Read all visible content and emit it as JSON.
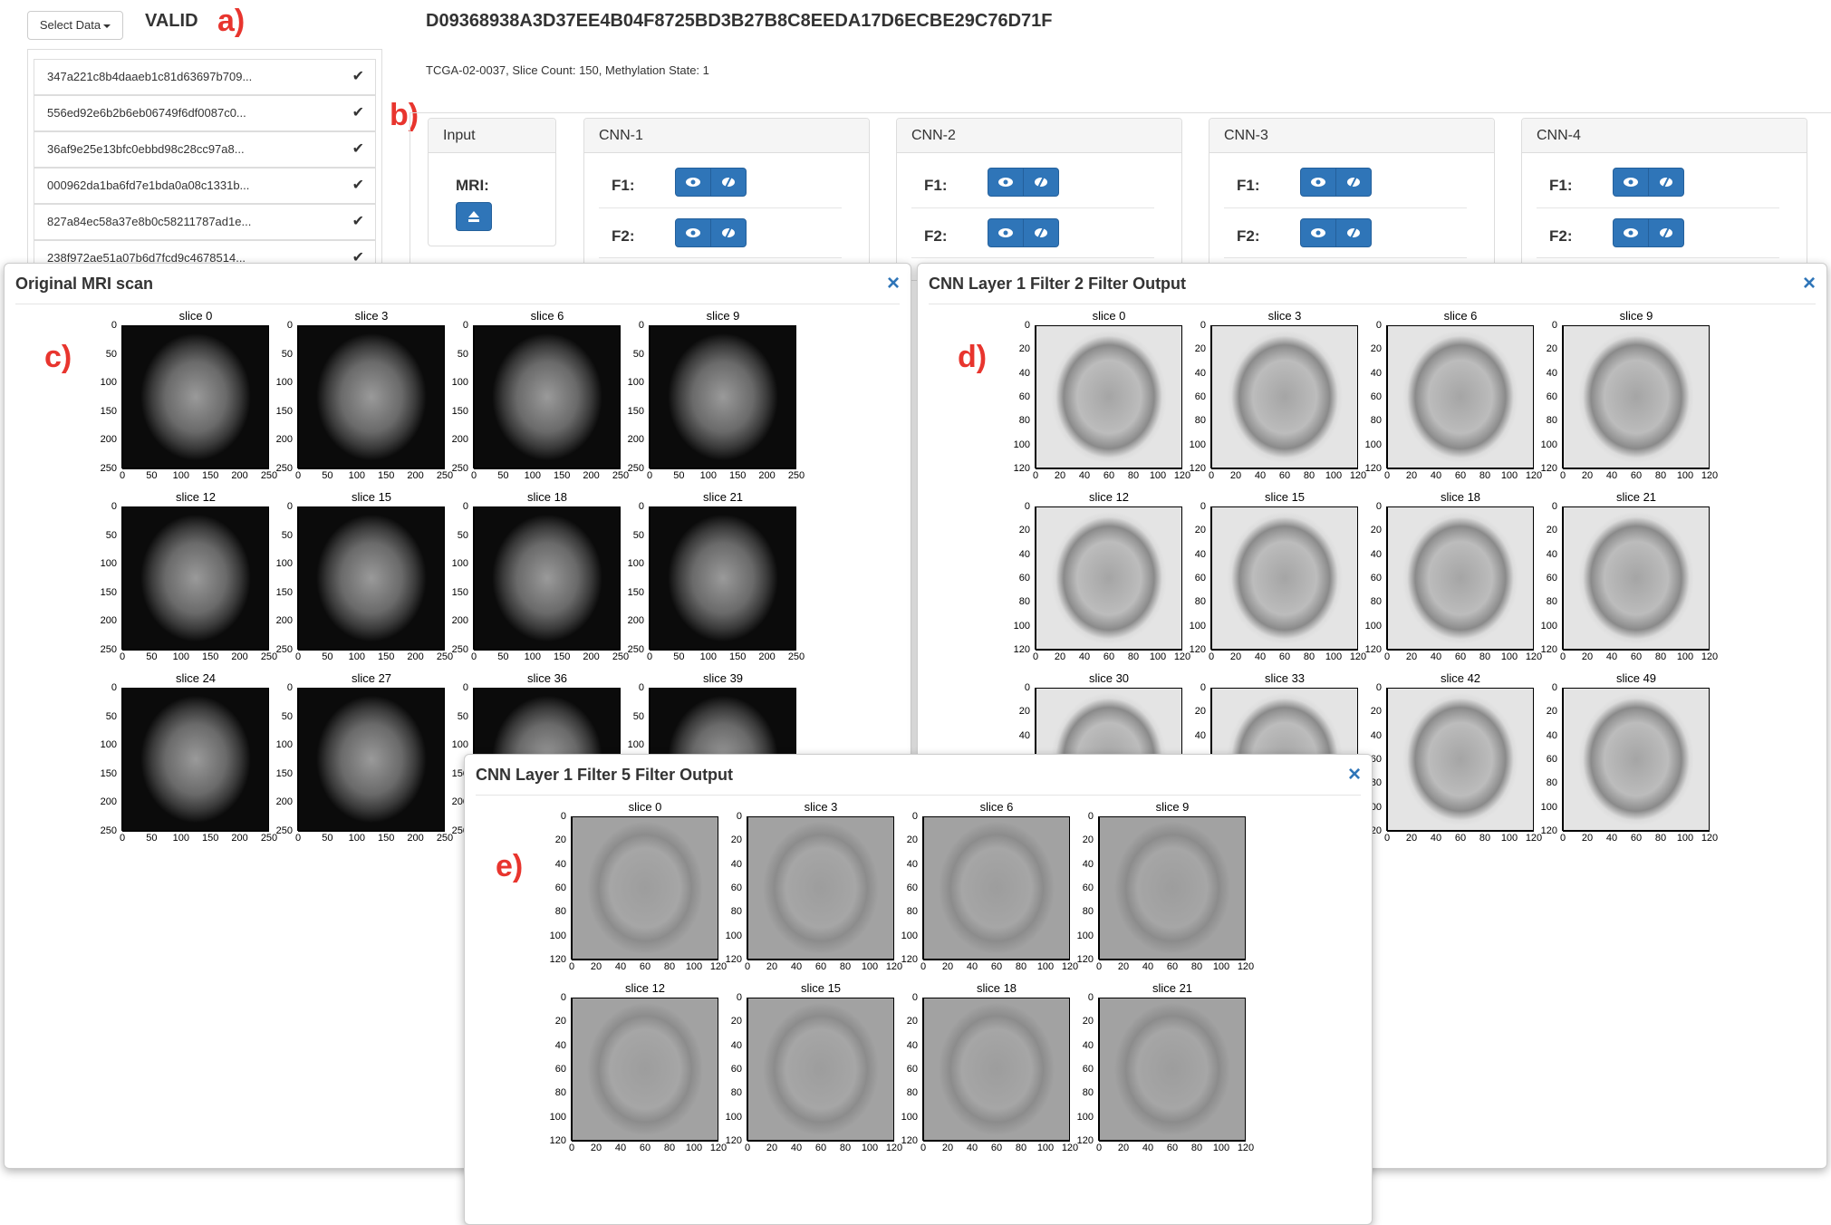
{
  "header": {
    "select_label": "Select Data",
    "status": "VALID",
    "hash": "D09368938A3D37EE4B04F8725BD3B27B8C8EEDA17D6ECBE29C76D71F",
    "meta": "TCGA-02-0037, Slice Count: 150, Methylation State: 1"
  },
  "annotations": {
    "a": "a)",
    "b": "b)",
    "c": "c)",
    "d": "d)",
    "e": "e)"
  },
  "list": {
    "items": [
      {
        "label": "347a221c8b4daaeb1c81d63697b709..."
      },
      {
        "label": "556ed92e6b2b6eb06749f6df0087c0..."
      },
      {
        "label": "36af9e25e13bfc0ebbd98c28cc97a8..."
      },
      {
        "label": "000962da1ba6fd7e1bda0a08c1331b..."
      },
      {
        "label": "827a84ec58a37e8b0c58211787ad1e..."
      },
      {
        "label": "238f972ae51a07b6d7fcd9c4678514..."
      }
    ]
  },
  "panels": {
    "input": {
      "title": "Input",
      "mri_label": "MRI:"
    },
    "cnn": [
      {
        "title": "CNN-1",
        "f1": "F1:",
        "f2": "F2:"
      },
      {
        "title": "CNN-2",
        "f1": "F1:",
        "f2": "F2:"
      },
      {
        "title": "CNN-3",
        "f1": "F1:",
        "f2": "F2:"
      },
      {
        "title": "CNN-4",
        "f1": "F1:",
        "f2": "F2:"
      }
    ]
  },
  "modals": {
    "c": {
      "title": "Original MRI scan",
      "close": "×"
    },
    "d": {
      "title": "CNN Layer 1 Filter 2 Filter Output",
      "close": "×"
    },
    "e": {
      "title": "CNN Layer 1 Filter 5 Filter Output",
      "close": "×"
    }
  },
  "slices": {
    "c": [
      "slice 0",
      "slice 3",
      "slice 6",
      "slice 9",
      "slice 12",
      "slice 15",
      "slice 18",
      "slice 21",
      "slice 24",
      "slice 27",
      "slice 36",
      "slice 39"
    ],
    "d": [
      "slice 0",
      "slice 3",
      "slice 6",
      "slice 9",
      "slice 12",
      "slice 15",
      "slice 18",
      "slice 21",
      "slice 30",
      "slice 33",
      "slice 42",
      "slice 49"
    ],
    "e": [
      "slice 0",
      "slice 3",
      "slice 6",
      "slice 9",
      "slice 12",
      "slice 15",
      "slice 18",
      "slice 21"
    ]
  },
  "ticks": {
    "big_y": [
      "0",
      "50",
      "100",
      "150",
      "200",
      "250"
    ],
    "big_x": [
      "0",
      "50",
      "100",
      "150",
      "200",
      "250"
    ],
    "small_y": [
      "0",
      "20",
      "40",
      "60",
      "80",
      "100",
      "120"
    ],
    "small_x": [
      "0",
      "20",
      "40",
      "60",
      "80",
      "100",
      "120"
    ]
  },
  "icons": {
    "eye": "eye-icon",
    "eye_slash": "eye-slash-icon",
    "eject": "eject-icon",
    "check": "check-icon",
    "close": "close-icon"
  }
}
